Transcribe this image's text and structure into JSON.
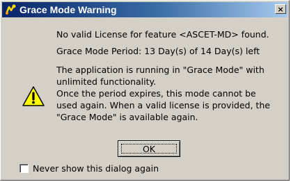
{
  "window": {
    "title": "Grace Mode Warning",
    "close_glyph": "×",
    "icon": "ascet-app-icon"
  },
  "message": {
    "icon": "warning-icon",
    "line1": "No valid License for feature <ASCET-MD> found.",
    "line2": "Grace Mode Period: 13 Day(s) of 14 Day(s) left",
    "paragraph": [
      "The application is running in \"Grace Mode\"  with",
      "unlimited functionality.",
      "Once the period expires, this mode cannot be",
      "used again. When a valid license is provided, the",
      "\"Grace Mode\" is available again."
    ]
  },
  "ok_button": {
    "label": "OK"
  },
  "checkbox": {
    "label": "Never show this dialog again",
    "checked": false
  },
  "colors": {
    "titlebar_start": "#0a246a",
    "titlebar_end": "#a6caf0",
    "dialog_bg": "#d4d0c8",
    "warning_yellow": "#ffff00"
  }
}
